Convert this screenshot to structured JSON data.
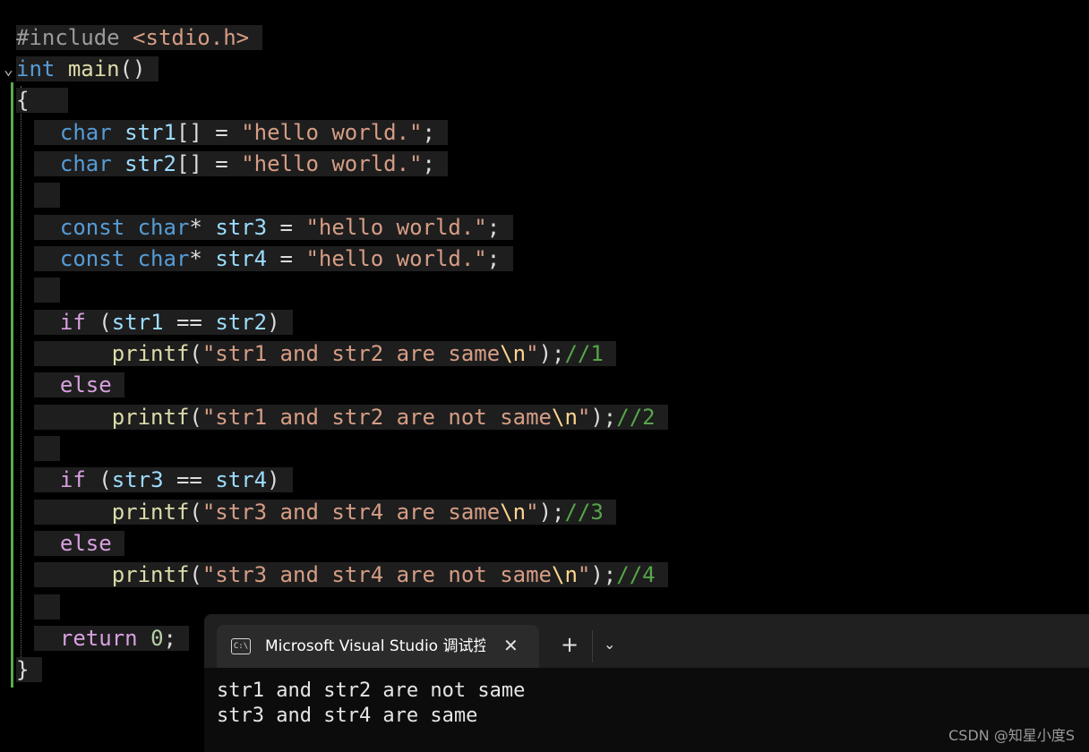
{
  "editor": {
    "code": {
      "l1": {
        "a": "#include ",
        "b": "<stdio.h>"
      },
      "l2": {
        "a": "int",
        "b": " ",
        "c": "main",
        "d": "()"
      },
      "l3": {
        "a": "{"
      },
      "l4": {
        "a": "char",
        "b": " ",
        "c": "str1",
        "d": "[] = ",
        "e": "\"hello world.\"",
        "f": ";"
      },
      "l5": {
        "a": "char",
        "b": " ",
        "c": "str2",
        "d": "[] = ",
        "e": "\"hello world.\"",
        "f": ";"
      },
      "l7": {
        "a": "const",
        "b": " ",
        "c": "char",
        "d": "* ",
        "e": "str3",
        "f": " = ",
        "g": "\"hello world.\"",
        "h": ";"
      },
      "l8": {
        "a": "const",
        "b": " ",
        "c": "char",
        "d": "* ",
        "e": "str4",
        "f": " = ",
        "g": "\"hello world.\"",
        "h": ";"
      },
      "l10": {
        "a": "if",
        "b": " (",
        "c": "str1",
        "d": " == ",
        "e": "str2",
        "f": ")"
      },
      "l11": {
        "a": "printf",
        "b": "(",
        "c": "\"str1 and str2 are same",
        "d": "\\n",
        "e": "\"",
        "f": ");",
        "g": "//1"
      },
      "l12": {
        "a": "else"
      },
      "l13": {
        "a": "printf",
        "b": "(",
        "c": "\"str1 and str2 are not same",
        "d": "\\n",
        "e": "\"",
        "f": ");",
        "g": "//2"
      },
      "l15": {
        "a": "if",
        "b": " (",
        "c": "str3",
        "d": " == ",
        "e": "str4",
        "f": ")"
      },
      "l16": {
        "a": "printf",
        "b": "(",
        "c": "\"str3 and str4 are same",
        "d": "\\n",
        "e": "\"",
        "f": ");",
        "g": "//3"
      },
      "l17": {
        "a": "else"
      },
      "l18": {
        "a": "printf",
        "b": "(",
        "c": "\"str3 and str4 are not same",
        "d": "\\n",
        "e": "\"",
        "f": ");",
        "g": "//4"
      },
      "l20": {
        "a": "return",
        "b": " ",
        "c": "0",
        "d": ";"
      },
      "l21": {
        "a": "}"
      }
    },
    "fold_icon": "chevron-down-icon"
  },
  "console": {
    "tab_title": "Microsoft Visual Studio 调试控制台",
    "tab_icon_text": "C:\\",
    "close_glyph": "✕",
    "new_tab_glyph": "+",
    "dropdown_glyph": "⌄",
    "output": [
      "str1 and str2 are not same",
      "str3 and str4 are same"
    ]
  },
  "watermark": "CSDN @知星小度S",
  "colors": {
    "background": "#000000",
    "keyword": "#569cd6",
    "control": "#d8a0df",
    "string": "#d69d85",
    "function": "#dcdcaa",
    "variable": "#9cdcfe",
    "comment": "#57a64a",
    "change_bar": "#5ba84f"
  }
}
